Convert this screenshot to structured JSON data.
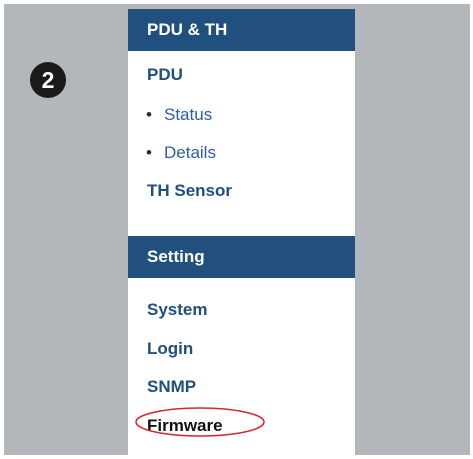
{
  "step_badge": "2",
  "sidebar": {
    "pdu_th": {
      "header": "PDU & TH",
      "pdu_label": "PDU",
      "items": [
        {
          "label": "Status"
        },
        {
          "label": "Details"
        }
      ],
      "th_sensor_label": "TH Sensor"
    },
    "setting": {
      "header": "Setting",
      "items": [
        {
          "label": "System"
        },
        {
          "label": "Login"
        },
        {
          "label": "SNMP"
        },
        {
          "label": "Firmware"
        }
      ]
    }
  },
  "colors": {
    "header_bg": "#214f7e",
    "link": "#214f7e",
    "sub_link": "#2d5da8",
    "highlight": "#d3252c",
    "frame_bg": "#b3b6ba"
  }
}
